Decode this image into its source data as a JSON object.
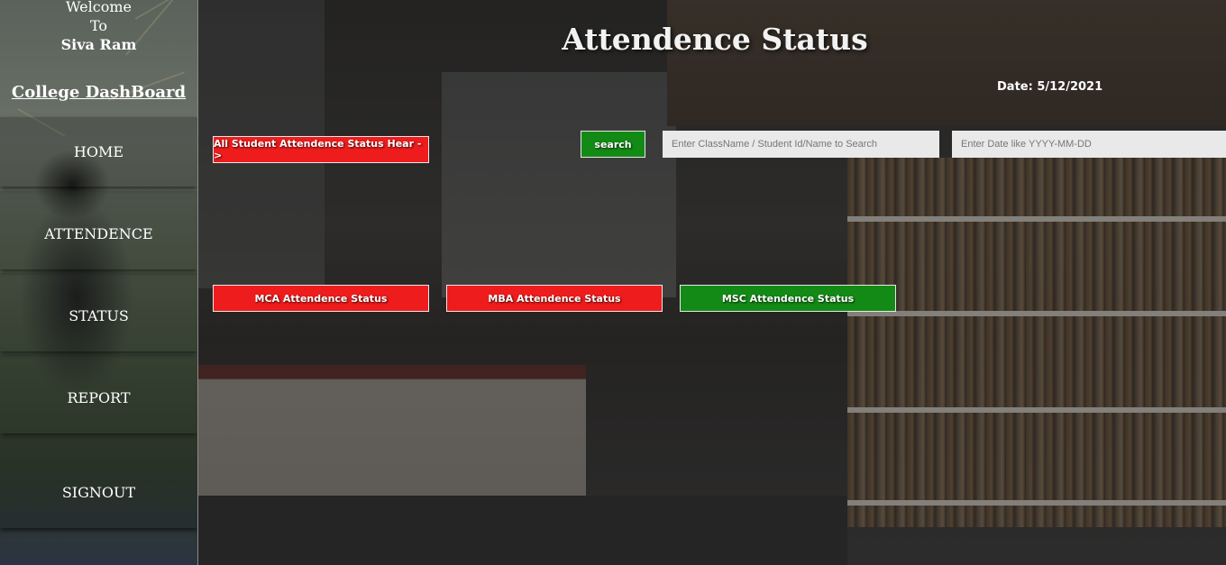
{
  "sidebar": {
    "welcome_lines": [
      "Welcome",
      "To",
      "Siva Ram"
    ],
    "title": "College DashBoard",
    "nav": [
      {
        "label": "HOME"
      },
      {
        "label": "ATTENDENCE"
      },
      {
        "label": "STATUS"
      },
      {
        "label": "REPORT"
      },
      {
        "label": "SIGNOUT"
      }
    ]
  },
  "main": {
    "title": "Attendence Status",
    "date": "Date: 5/12/2021",
    "all_status_button": "All Student Attendence Status Hear ->",
    "search_button": "search",
    "search_input_placeholder": "Enter ClassName / Student Id/Name to Search",
    "date_input_placeholder": "Enter Date like YYYY-MM-DD",
    "course_buttons": [
      {
        "label": "MCA Attendence Status",
        "color": "#ee1c1c"
      },
      {
        "label": "MBA Attendence Status",
        "color": "#ee1c1c"
      },
      {
        "label": "MSC Attendence Status",
        "color": "#138a15"
      }
    ]
  },
  "colors": {
    "red_button": "#ee1c1c",
    "green_button": "#138a15",
    "input_bg": "#e9e9e9"
  }
}
